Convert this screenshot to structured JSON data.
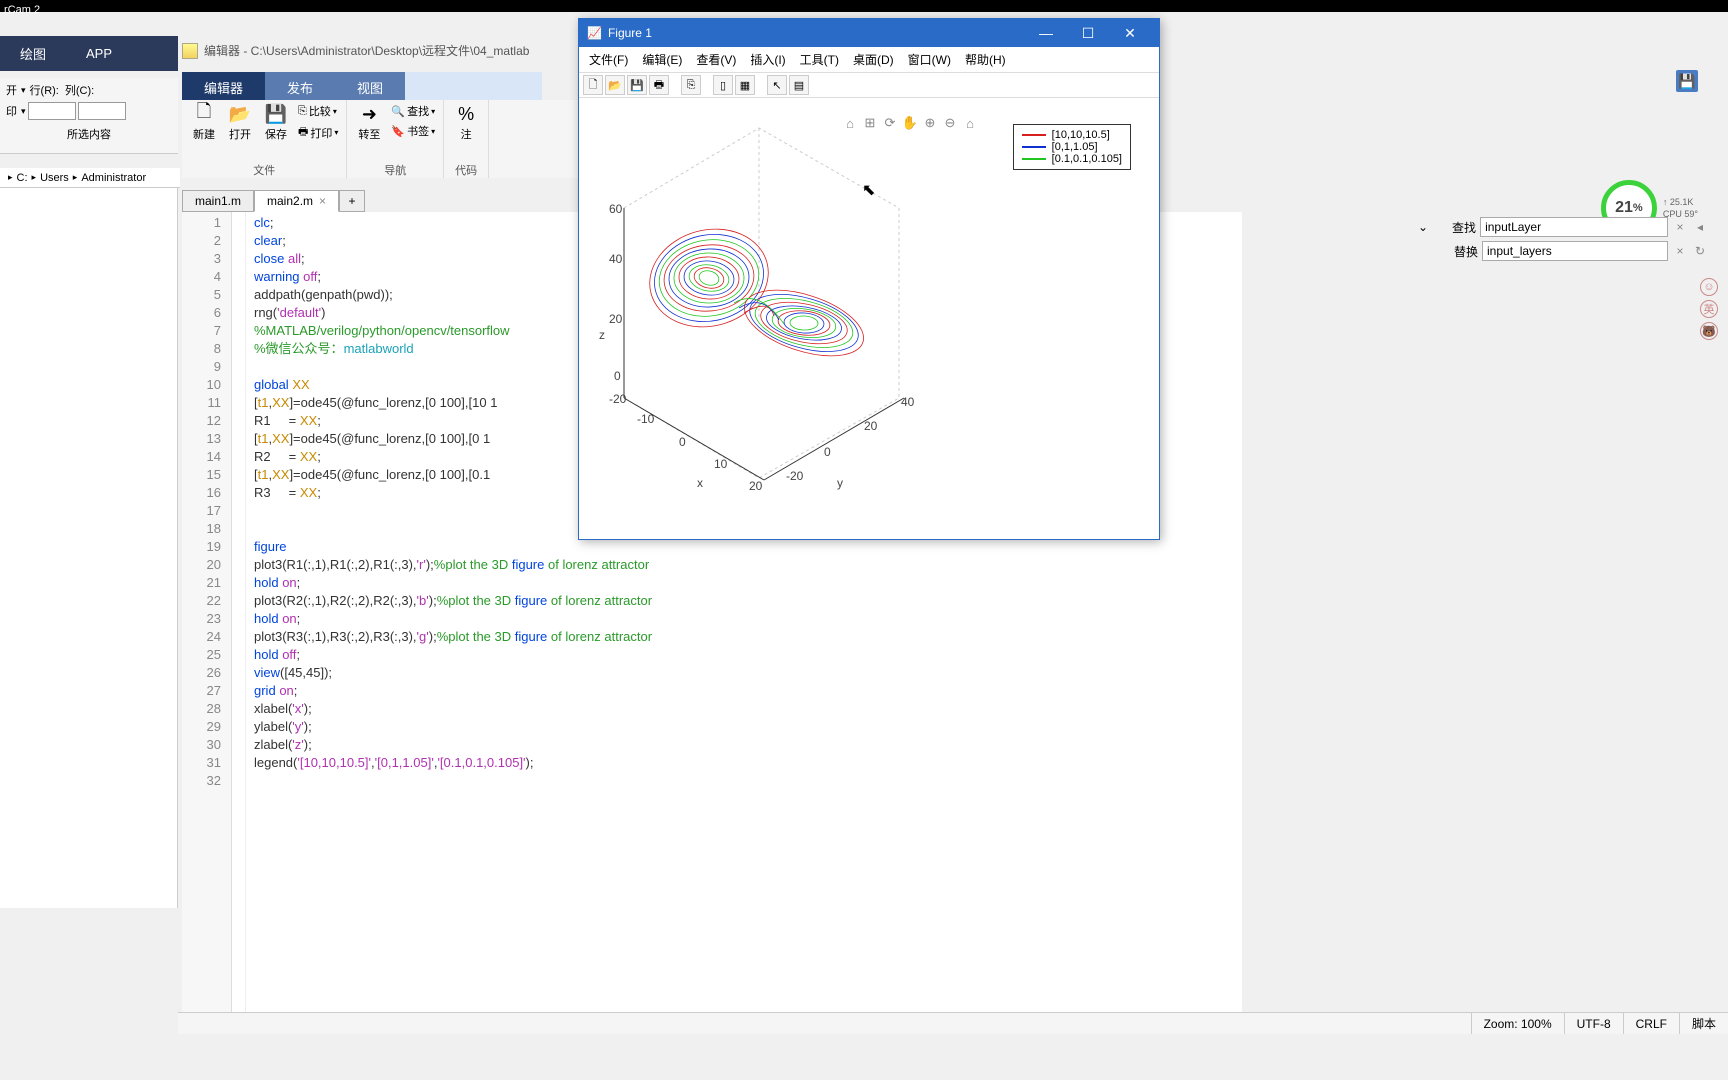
{
  "taskbar": {
    "label": "rCam 2"
  },
  "ribbon": {
    "tabs": [
      {
        "label": "绘图"
      },
      {
        "label": "APP"
      }
    ]
  },
  "nav": {
    "row_label": "行(R):",
    "col_label": "列(C):",
    "sel_label": "所选内容"
  },
  "toolbar": {
    "open_label": "开",
    "print_label": "印",
    "new": "新建",
    "open": "打开",
    "save": "保存",
    "compare": "比较",
    "print": "打印",
    "group_file": "文件",
    "goto": "转至",
    "find": "查找",
    "bookmark": "书签",
    "group_nav": "导航",
    "insert": "注",
    "group_code": "代码"
  },
  "editor": {
    "title_prefix": "编辑器 - ",
    "path": "C:\\Users\\Administrator\\Desktop\\远程文件\\04_matlab",
    "tabs": {
      "editor": "编辑器",
      "publish": "发布",
      "view": "视图"
    }
  },
  "breadcrumb": {
    "items": [
      "C:",
      "Users",
      "Administrator"
    ]
  },
  "file_tabs": {
    "tab1": "main1.m",
    "tab2": "main2.m",
    "add": "+"
  },
  "code": {
    "lines": [
      {
        "n": "1",
        "raw": "clc;"
      },
      {
        "n": "2",
        "raw": "clear;"
      },
      {
        "n": "3",
        "raw": "close all;"
      },
      {
        "n": "4",
        "raw": "warning off;"
      },
      {
        "n": "5",
        "raw": "addpath(genpath(pwd));"
      },
      {
        "n": "6",
        "raw": "rng('default')"
      },
      {
        "n": "7",
        "raw": "%MATLAB/verilog/python/opencv/tensorflow"
      },
      {
        "n": "8",
        "raw": "%微信公众号：matlabworld"
      },
      {
        "n": "9",
        "raw": ""
      },
      {
        "n": "10",
        "raw": "global XX"
      },
      {
        "n": "11",
        "raw": "[t1,XX]=ode45(@func_lorenz,[0 100],[10 1"
      },
      {
        "n": "12",
        "raw": "R1     = XX;"
      },
      {
        "n": "13",
        "raw": "[t1,XX]=ode45(@func_lorenz,[0 100],[0 1"
      },
      {
        "n": "14",
        "raw": "R2     = XX;"
      },
      {
        "n": "15",
        "raw": "[t1,XX]=ode45(@func_lorenz,[0 100],[0.1"
      },
      {
        "n": "16",
        "raw": "R3     = XX;"
      },
      {
        "n": "17",
        "raw": ""
      },
      {
        "n": "18",
        "raw": ""
      },
      {
        "n": "19",
        "raw": "figure"
      },
      {
        "n": "20",
        "raw": "plot3(R1(:,1),R1(:,2),R1(:,3),'r');%plot the 3D figure of lorenz attractor"
      },
      {
        "n": "21",
        "raw": "hold on;"
      },
      {
        "n": "22",
        "raw": "plot3(R2(:,1),R2(:,2),R2(:,3),'b');%plot the 3D figure of lorenz attractor"
      },
      {
        "n": "23",
        "raw": "hold on;"
      },
      {
        "n": "24",
        "raw": "plot3(R3(:,1),R3(:,2),R3(:,3),'g');%plot the 3D figure of lorenz attractor"
      },
      {
        "n": "25",
        "raw": "hold off;"
      },
      {
        "n": "26",
        "raw": "view([45,45]);"
      },
      {
        "n": "27",
        "raw": "grid on;"
      },
      {
        "n": "28",
        "raw": "xlabel('x');"
      },
      {
        "n": "29",
        "raw": "ylabel('y');"
      },
      {
        "n": "30",
        "raw": "zlabel('z');"
      },
      {
        "n": "31",
        "raw": "legend('[10,10,10.5]','[0,1,1.05]','[0.1,0.1,0.105]');"
      },
      {
        "n": "32",
        "raw": ""
      }
    ]
  },
  "figure": {
    "title": "Figure 1",
    "menus": [
      "文件(F)",
      "编辑(E)",
      "查看(V)",
      "插入(I)",
      "工具(T)",
      "桌面(D)",
      "窗口(W)",
      "帮助(H)"
    ],
    "legend": {
      "items": [
        {
          "color": "#d62020",
          "label": "[10,10,10.5]"
        },
        {
          "color": "#1030d0",
          "label": "[0,1,1.05]"
        },
        {
          "color": "#20c520",
          "label": "[0.1,0.1,0.105]"
        }
      ]
    },
    "axes": {
      "x": "x",
      "y": "y",
      "z": "z"
    },
    "ticks": {
      "z": [
        "0",
        "20",
        "40",
        "60"
      ],
      "x": [
        "-20",
        "-10",
        "0",
        "10",
        "20"
      ],
      "y": [
        "-20",
        "0",
        "20",
        "40"
      ]
    }
  },
  "find_replace": {
    "find_label": "查找",
    "replace_label": "替换",
    "find_value": "inputLayer",
    "replace_value": "input_layers",
    "chevron": "⌄"
  },
  "cpu": {
    "pct": "21",
    "suffix": "%",
    "l1": "↑ 25.1K",
    "l2": "CPU 59°"
  },
  "status": {
    "zoom": "Zoom: 100%",
    "encoding": "UTF-8",
    "eol": "CRLF",
    "mode": "脚本"
  },
  "chart_data": {
    "type": "line",
    "title": "",
    "xlabel": "x",
    "ylabel": "y",
    "zlabel": "z",
    "xlim": [
      -20,
      20
    ],
    "ylim": [
      -20,
      40
    ],
    "zlim": [
      0,
      60
    ],
    "series": [
      {
        "name": "[10,10,10.5]",
        "color": "#d62020",
        "note": "Lorenz trajectory from IC [10,10,10.5]"
      },
      {
        "name": "[0,1,1.05]",
        "color": "#1030d0",
        "note": "Lorenz trajectory from IC [0,1,1.05]"
      },
      {
        "name": "[0.1,0.1,0.105]",
        "color": "#20c520",
        "note": "Lorenz trajectory from IC [0.1,0.1,0.105]"
      }
    ],
    "view": [
      45,
      45
    ],
    "grid": true,
    "description": "3D Lorenz attractor (butterfly); two lobes centered approximately at (x≈±9, y≈±9, z≈27); data is continuous chaotic trajectory, not discrete points."
  }
}
